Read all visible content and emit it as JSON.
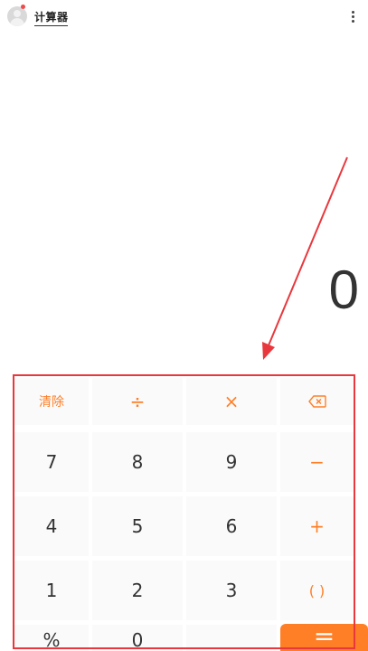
{
  "header": {
    "app_title": "计算器"
  },
  "display": {
    "value": "0"
  },
  "keypad": {
    "rows": [
      [
        "清除",
        "÷",
        "×",
        "⌫"
      ],
      [
        "7",
        "8",
        "9",
        "−"
      ],
      [
        "4",
        "5",
        "6",
        "+"
      ],
      [
        "1",
        "2",
        "3",
        "( )"
      ],
      [
        "%",
        "0",
        "",
        "="
      ]
    ]
  },
  "colors": {
    "accent": "#ff7f27",
    "annotation": "#e8383d"
  }
}
